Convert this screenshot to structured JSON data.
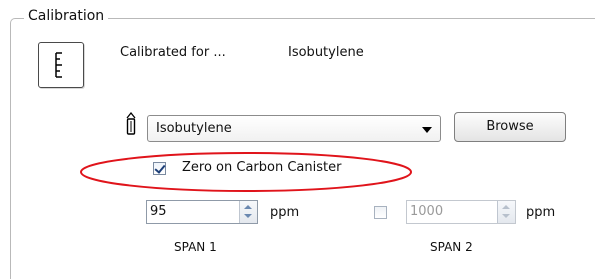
{
  "group": {
    "title": "Calibration"
  },
  "calibrated": {
    "label": "Calibrated for ...",
    "gas": "Isobutylene"
  },
  "gas_select": {
    "value": "Isobutylene"
  },
  "browse_button": {
    "label": "Browse"
  },
  "zero_option": {
    "label": "Zero on Carbon Canister",
    "checked": true
  },
  "span1": {
    "value": "95",
    "unit": "ppm",
    "caption": "SPAN 1"
  },
  "span2": {
    "enabled": false,
    "value": "1000",
    "unit": "ppm",
    "caption": "SPAN 2"
  },
  "colors": {
    "annotation": "#e0141b",
    "accent": "#1d3f78"
  },
  "icons": [
    "calibration-gauge-icon",
    "gas-flask-icon",
    "chevron-down-icon",
    "spin-up-icon",
    "spin-down-icon"
  ]
}
